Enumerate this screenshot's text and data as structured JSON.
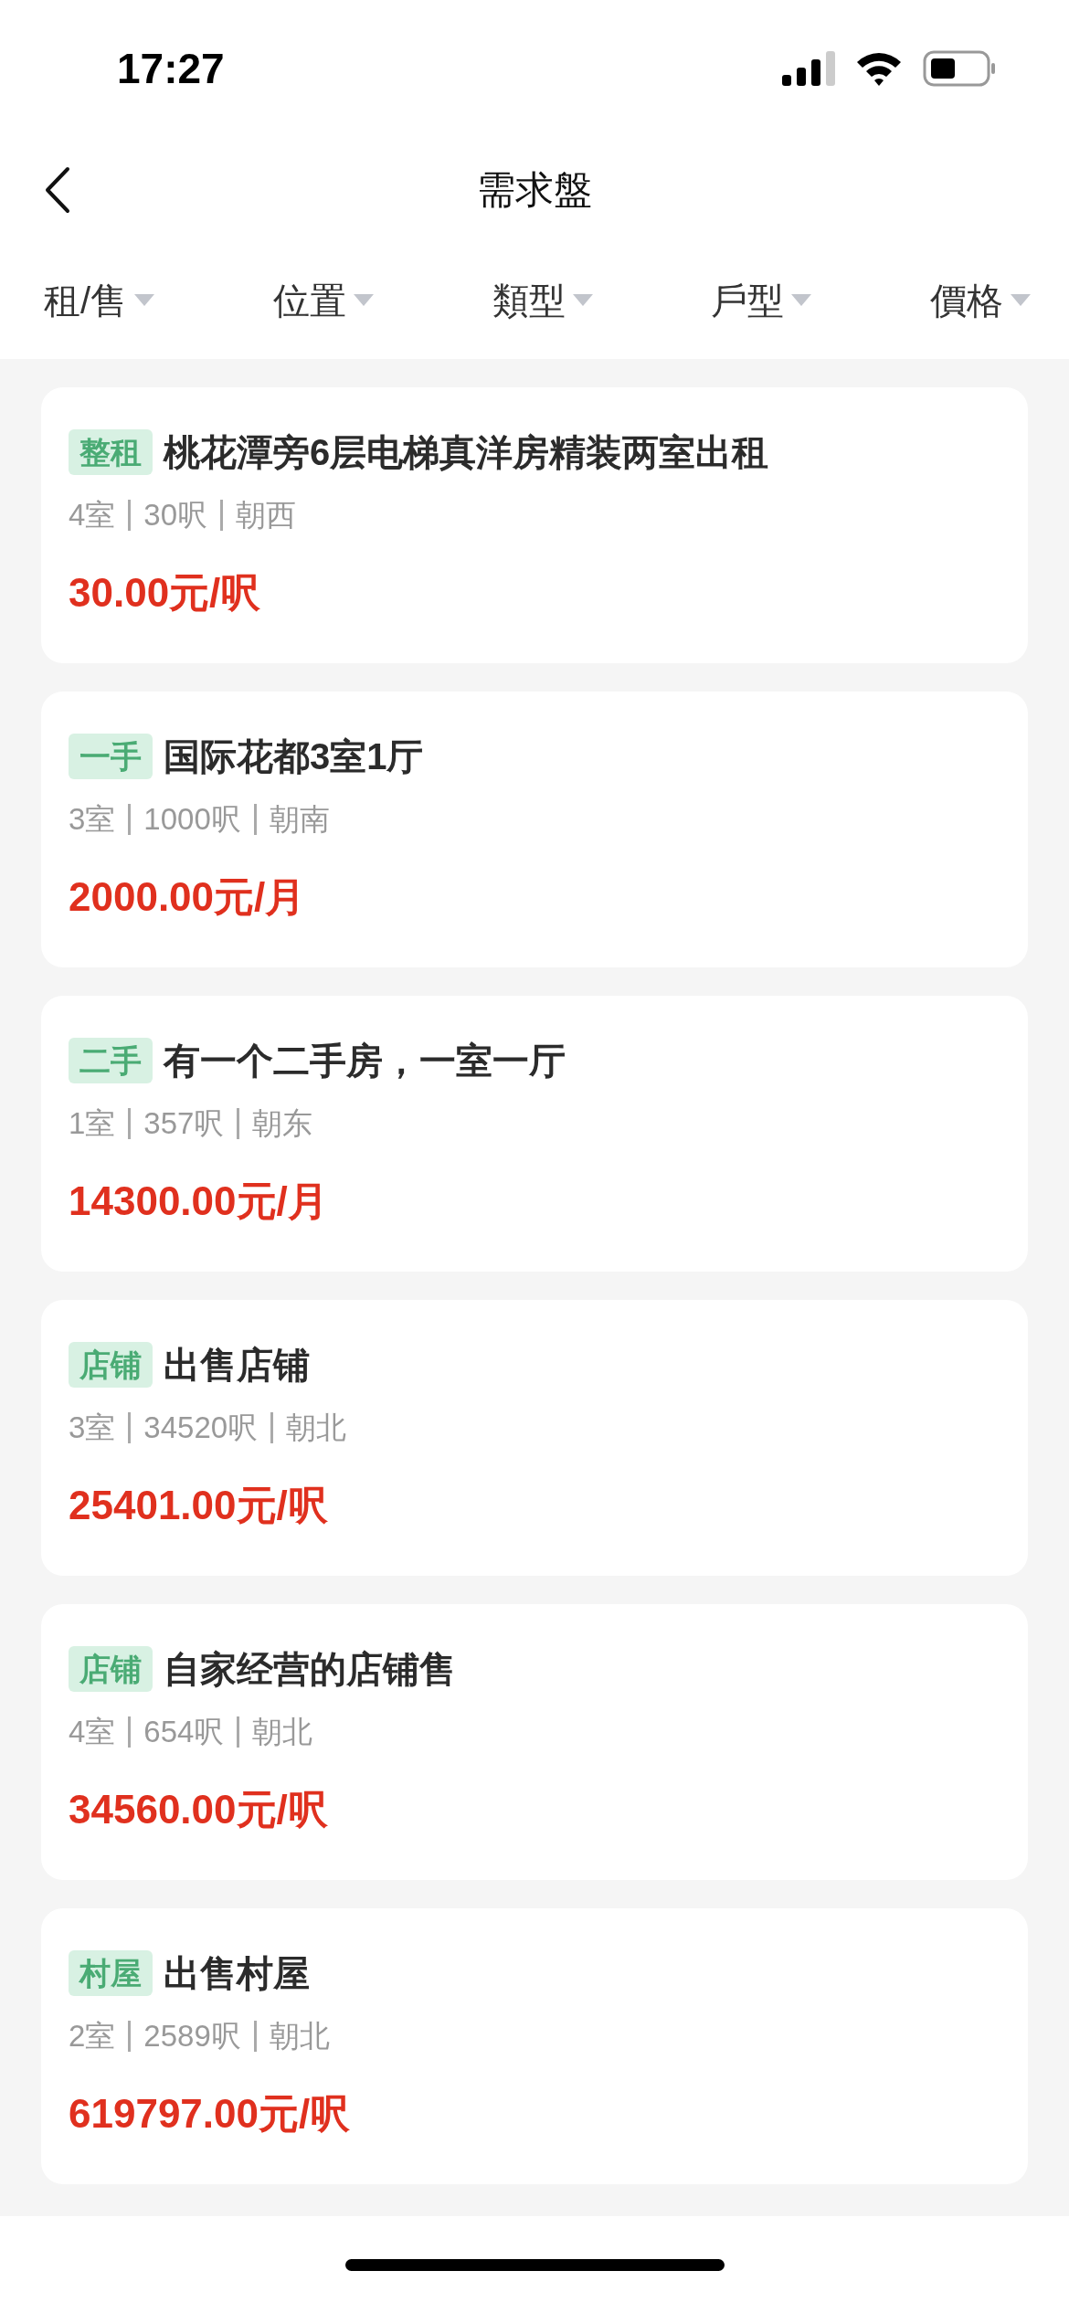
{
  "status_bar": {
    "time": "17:27"
  },
  "header": {
    "title": "需求盤"
  },
  "filters": [
    {
      "label": "租/售"
    },
    {
      "label": "位置"
    },
    {
      "label": "類型"
    },
    {
      "label": "戶型"
    },
    {
      "label": "價格"
    }
  ],
  "listings": [
    {
      "tag": "整租",
      "title": "桃花潭旁6层电梯真洋房精装两室出租",
      "details": [
        "4室",
        "30呎",
        "朝西"
      ],
      "price": "30.00元/呎"
    },
    {
      "tag": "一手",
      "title": "国际花都3室1厅",
      "details": [
        "3室",
        "1000呎",
        "朝南"
      ],
      "price": "2000.00元/月"
    },
    {
      "tag": "二手",
      "title": "有一个二手房，一室一厅",
      "details": [
        "1室",
        "357呎",
        "朝东"
      ],
      "price": "14300.00元/月"
    },
    {
      "tag": "店铺",
      "title": "出售店铺",
      "details": [
        "3室",
        "34520呎",
        "朝北"
      ],
      "price": "25401.00元/呎"
    },
    {
      "tag": "店铺",
      "title": "自家经营的店铺售",
      "details": [
        "4室",
        "654呎",
        "朝北"
      ],
      "price": "34560.00元/呎"
    },
    {
      "tag": "村屋",
      "title": "出售村屋",
      "details": [
        "2室",
        "2589呎",
        "朝北"
      ],
      "price": "619797.00元/呎"
    }
  ]
}
